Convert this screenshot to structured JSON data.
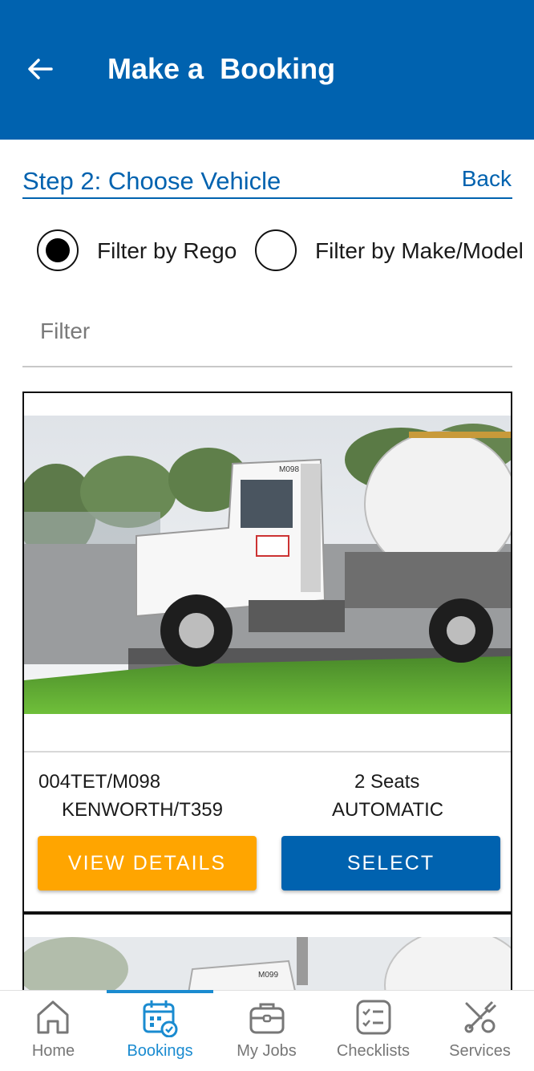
{
  "header": {
    "title": "Make a  Booking"
  },
  "step": {
    "title": "Step 2: Choose Vehicle",
    "back_label": "Back"
  },
  "filter_options": [
    {
      "label": "Filter by Rego",
      "selected": true
    },
    {
      "label": "Filter by Make/Model",
      "selected": false
    }
  ],
  "filter": {
    "placeholder": "Filter",
    "value": ""
  },
  "vehicles": [
    {
      "rego": "004TET/M098",
      "seats": "2 Seats",
      "make_model": "KENWORTH/T359",
      "transmission": "AUTOMATIC",
      "cab_text": "M098",
      "view_label": "VIEW DETAILS",
      "select_label": "SELECT"
    },
    {
      "cab_text": "M099"
    }
  ],
  "nav": [
    {
      "label": "Home",
      "icon": "home-icon",
      "active": false
    },
    {
      "label": "Bookings",
      "icon": "calendar-check-icon",
      "active": true
    },
    {
      "label": "My Jobs",
      "icon": "briefcase-icon",
      "active": false
    },
    {
      "label": "Checklists",
      "icon": "checklist-icon",
      "active": false
    },
    {
      "label": "Services",
      "icon": "tools-icon",
      "active": false
    }
  ],
  "colors": {
    "primary": "#0062af",
    "accent": "#ffa500",
    "nav_active": "#1a8bd0",
    "nav_inactive": "#777777"
  }
}
